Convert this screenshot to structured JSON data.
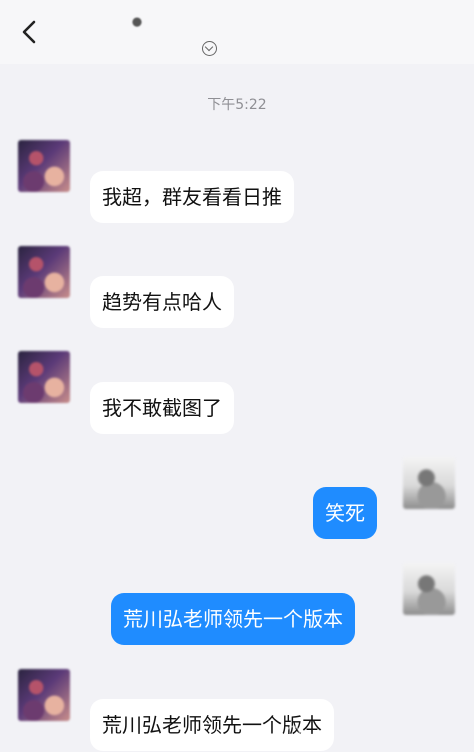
{
  "header": {
    "title": "",
    "subtitle": "",
    "back_icon": "back-icon",
    "subtitle_icon": "chevron-circle-icon"
  },
  "timestamp": "下午5:22",
  "messages": [
    {
      "direction": "incoming",
      "sender": "",
      "text": "我超，群友看看日推"
    },
    {
      "direction": "incoming",
      "sender": "",
      "text": "趋势有点哈人"
    },
    {
      "direction": "incoming",
      "sender": "",
      "text": "我不敢截图了"
    },
    {
      "direction": "outgoing",
      "sender": "",
      "text": "笑死"
    },
    {
      "direction": "outgoing",
      "sender": "",
      "text": "荒川弘老师领先一个版本"
    },
    {
      "direction": "incoming",
      "sender": "",
      "text": "荒川弘老师领先一个版本"
    }
  ],
  "watermark": {
    "text": ""
  },
  "colors": {
    "background": "#f2f2f6",
    "outgoing_bubble": "#1f8cff",
    "incoming_bubble": "#ffffff"
  }
}
